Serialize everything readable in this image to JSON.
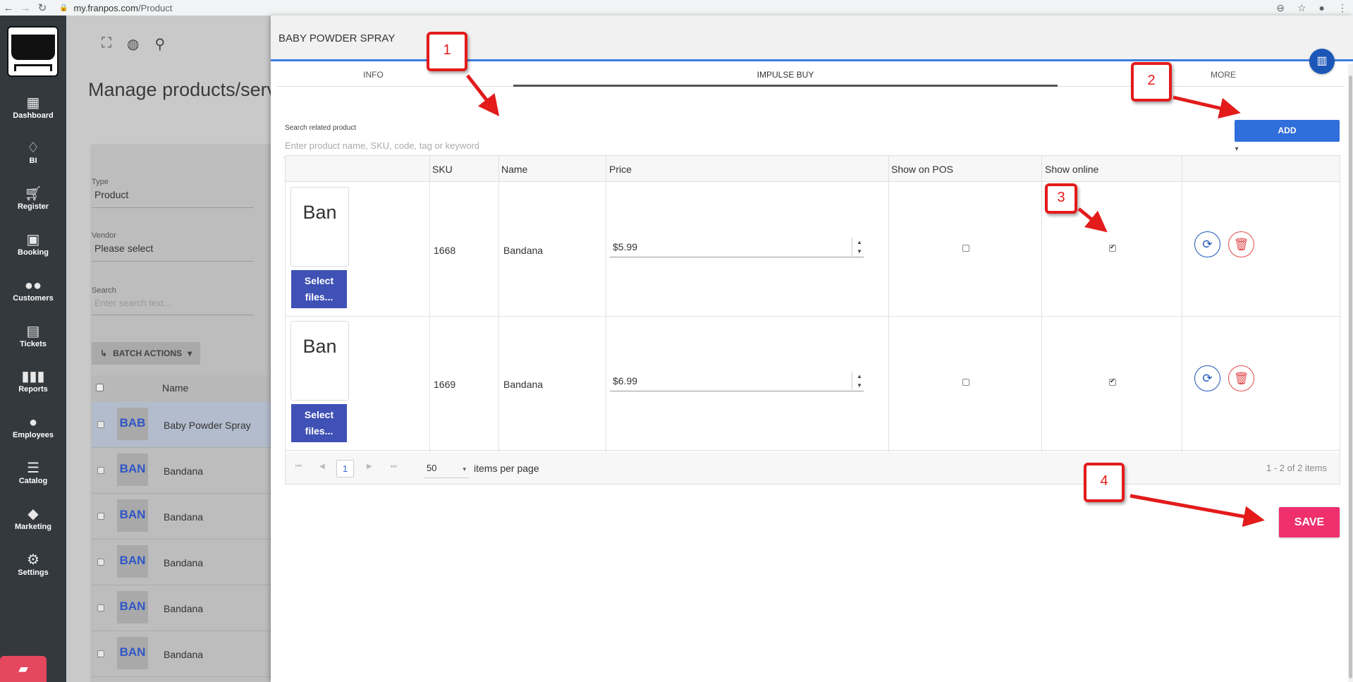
{
  "browser": {
    "domain": "my.franpos.com",
    "path": "/Product"
  },
  "sidebar": {
    "items": [
      {
        "label": "Dashboard",
        "icon": "dashboard-icon"
      },
      {
        "label": "BI",
        "icon": "lightbulb-icon"
      },
      {
        "label": "Register",
        "icon": "cart-icon"
      },
      {
        "label": "Booking",
        "icon": "calendar-icon"
      },
      {
        "label": "Customers",
        "icon": "people-icon"
      },
      {
        "label": "Tickets",
        "icon": "ticket-icon"
      },
      {
        "label": "Reports",
        "icon": "bar-chart-icon"
      },
      {
        "label": "Employees",
        "icon": "person-icon"
      },
      {
        "label": "Catalog",
        "icon": "list-icon"
      },
      {
        "label": "Marketing",
        "icon": "tag-icon"
      },
      {
        "label": "Settings",
        "icon": "gear-icon"
      }
    ]
  },
  "background_page": {
    "title": "Manage products/serv",
    "type_label": "Type",
    "type_value": "Product",
    "vendor_label": "Vendor",
    "vendor_value": "Please select",
    "search_label": "Search",
    "search_placeholder": "Enter search text...",
    "batch_actions": "BATCH ACTIONS",
    "name_header": "Name",
    "rows": [
      {
        "thumb": "BAB",
        "name": "Baby Powder Spray"
      },
      {
        "thumb": "BAN",
        "name": "Bandana"
      },
      {
        "thumb": "BAN",
        "name": "Bandana"
      },
      {
        "thumb": "BAN",
        "name": "Bandana"
      },
      {
        "thumb": "BAN",
        "name": "Bandana"
      },
      {
        "thumb": "BAN",
        "name": "Bandana"
      }
    ]
  },
  "panel": {
    "title": "BABY POWDER SPRAY",
    "tabs": [
      "INFO",
      "IMPULSE BUY",
      "MORE"
    ],
    "active_tab": "IMPULSE BUY",
    "search_label": "Search related product",
    "search_placeholder": "Enter product name, SKU, code, tag or keyword",
    "add_label": "ADD",
    "columns": [
      "SKU",
      "Name",
      "Price",
      "Show on POS",
      "Show online"
    ],
    "rows": [
      {
        "image_text": "Ban",
        "select_files": "Select files...",
        "sku": "1668",
        "name": "Bandana",
        "price": "$5.99",
        "show_on_pos": false,
        "show_online": true
      },
      {
        "image_text": "Ban",
        "select_files": "Select files...",
        "sku": "1669",
        "name": "Bandana",
        "price": "$6.99",
        "show_on_pos": false,
        "show_online": true
      }
    ],
    "pager": {
      "current_page": "1",
      "per_page": "50",
      "per_page_label": "items per page",
      "info": "1 - 2 of 2 items"
    },
    "save_label": "SAVE"
  },
  "callouts": [
    "1",
    "2",
    "3",
    "4"
  ],
  "colors": {
    "sidebar": "#34393e",
    "primary": "#2f6edb",
    "save": "#ef2f6e",
    "callout": "#e31b1b",
    "select_files": "#3f51b5"
  }
}
